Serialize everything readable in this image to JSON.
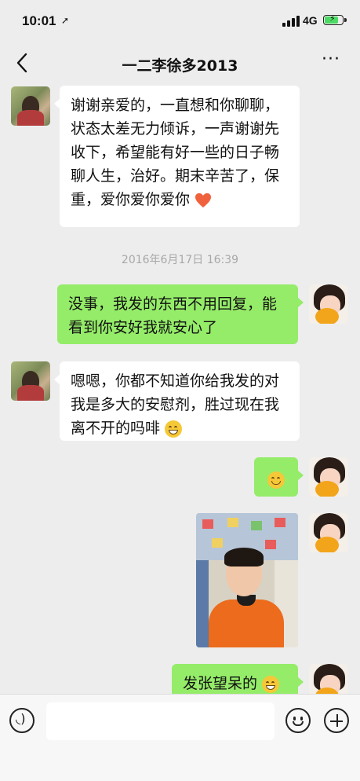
{
  "status_bar": {
    "time": "10:01",
    "location_icon": "location-arrow-icon",
    "network": "4G",
    "battery": "charging"
  },
  "nav": {
    "title": "一二李徐多2013",
    "back_icon": "chevron-left-icon",
    "more_icon": "ellipsis-icon",
    "more_label": "···"
  },
  "messages": [
    {
      "side": "left",
      "text": "谢谢亲爱的，一直想和你聊聊，状态太差无力倾诉，一声谢谢先收下，希望能有好一些的日子畅聊人生，治好。期末辛苦了，保重，爱你爱你爱你",
      "emoji": "heart-emoji"
    },
    {
      "side": "right",
      "text": "没事，我发的东西不用回复，能看到你安好我就安心了"
    },
    {
      "side": "left",
      "text": "嗯嗯，你都不知道你给我发的对我是多大的安慰剂，胜过现在我离不开的吗啡",
      "emoji": "grin-emoji"
    },
    {
      "side": "right",
      "text": "",
      "emoji": "smile-emoji"
    },
    {
      "side": "right",
      "type": "image",
      "image": "photo-of-boy-in-orange-shirt"
    },
    {
      "side": "right",
      "text": "发张望呆的",
      "emoji": "grin-emoji"
    }
  ],
  "timestamp": "2016年6月17日 16:39",
  "input_bar": {
    "placeholder": "",
    "voice_icon": "voice-icon",
    "emoji_icon": "emoji-icon",
    "plus_icon": "plus-icon"
  }
}
